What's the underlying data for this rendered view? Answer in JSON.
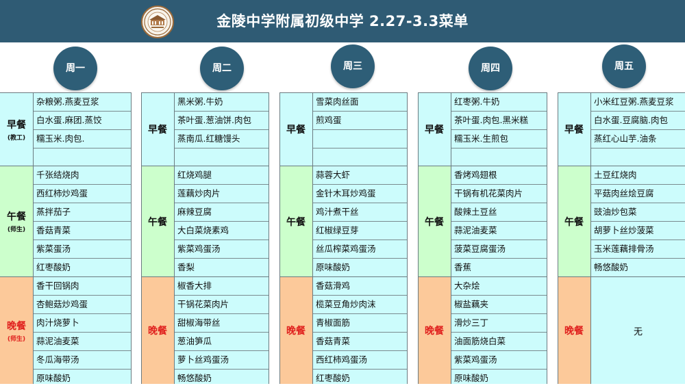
{
  "header": {
    "title": "金陵中学附属初级中学 2.27-3.3菜单",
    "logo_icon": "school-seal-icon",
    "bg_color": "#2f5b74"
  },
  "colors": {
    "breakfast_label_bg": "#ccfcfc",
    "lunch_label_bg": "#ccffcc",
    "dinner_label_bg": "#fcc99a",
    "item_bg": "#ccfcfc",
    "dinner_label_text": "#e0211e"
  },
  "days": [
    "周一",
    "周二",
    "周三",
    "周四",
    "周五"
  ],
  "meal_labels": {
    "breakfast": "早餐",
    "lunch": "午餐",
    "dinner": "晚餐",
    "breakfast_note": "(教工)",
    "lunch_note": "(师生)",
    "dinner_note": "(师生)"
  },
  "menu": [
    {
      "breakfast": [
        "杂粮粥.燕麦豆浆",
        "白水蛋.麻团.蒸饺",
        "糯玉米.肉包.",
        ""
      ],
      "lunch": [
        "千张结烧肉",
        "西红柿炒鸡蛋",
        "蒸拌茄子",
        "香菇青菜",
        "紫菜蛋汤",
        "红枣酸奶"
      ],
      "dinner": [
        "香干回锅肉",
        "杏鲍菇炒鸡蛋",
        "肉汁烧萝卜",
        "蒜泥油麦菜",
        "冬瓜海带汤",
        "原味酸奶"
      ]
    },
    {
      "breakfast": [
        "黑米粥.牛奶",
        "茶叶蛋.葱油饼.肉包",
        "蒸南瓜.红糖馒头",
        ""
      ],
      "lunch": [
        "红烧鸡腿",
        "莲藕炒肉片",
        "麻辣豆腐",
        "大白菜烧素鸡",
        "紫菜鸡蛋汤",
        "香梨"
      ],
      "dinner": [
        "椒香大排",
        "干锅花菜肉片",
        "甜椒海带丝",
        "葱油笋瓜",
        "萝卜丝鸡蛋汤",
        "畅悠酸奶"
      ]
    },
    {
      "breakfast": [
        "雪菜肉丝面",
        "煎鸡蛋",
        "",
        ""
      ],
      "lunch": [
        "蒜蓉大虾",
        "金针木耳炒鸡蛋",
        "鸡汁煮干丝",
        "红椒绿豆芽",
        "丝瓜榨菜鸡蛋汤",
        "原味酸奶"
      ],
      "dinner": [
        "香菇滑鸡",
        "榄菜豆角炒肉沫",
        "青椒面筋",
        "香菇青菜",
        "西红柿鸡蛋汤",
        "红枣酸奶"
      ]
    },
    {
      "breakfast": [
        "红枣粥.牛奶",
        "茶叶蛋.肉包.黑米糕",
        "糯玉米.生煎包",
        ""
      ],
      "lunch": [
        "香烤鸡翅根",
        "干锅有机花菜肉片",
        "酸辣土豆丝",
        "蒜泥油麦菜",
        "菠菜豆腐蛋汤",
        "香蕉"
      ],
      "dinner": [
        "大杂烩",
        "椒盐藕夹",
        "滑炒三丁",
        "油面筋烧白菜",
        "紫菜鸡蛋汤",
        "原味酸奶"
      ]
    },
    {
      "breakfast": [
        "小米红豆粥.燕麦豆浆",
        "白水蛋.豆腐脑.肉包",
        "蒸红心山芋.油条",
        ""
      ],
      "lunch": [
        "土豆红烧肉",
        "平菇肉丝烩豆腐",
        "豉油炒包菜",
        "胡萝卜丝炒菠菜",
        "玉米莲藕排骨汤",
        "畅悠酸奶"
      ],
      "dinner_none": "无"
    }
  ]
}
